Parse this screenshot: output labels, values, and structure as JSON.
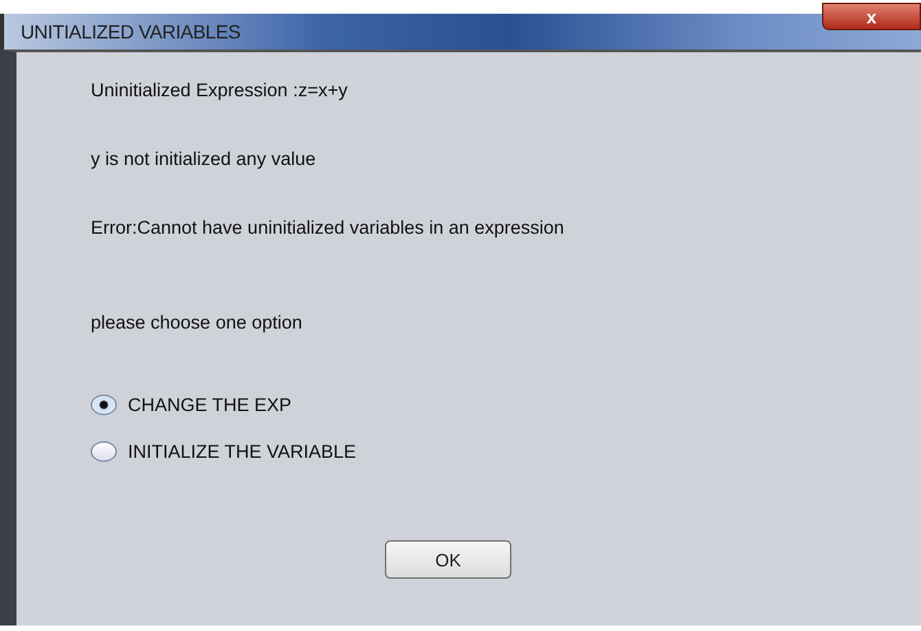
{
  "window": {
    "title": "UNITIALIZED VARIABLES",
    "close": "x"
  },
  "messages": [
    "Uninitialized Expression :z=x+y",
    "y is not initialized any value",
    "Error:Cannot have uninitialized variables in an expression"
  ],
  "prompt": "please choose one option",
  "options": [
    {
      "label": "CHANGE THE EXP",
      "selected": true
    },
    {
      "label": "INITIALIZE THE VARIABLE",
      "selected": false
    }
  ],
  "buttons": [
    "OK"
  ]
}
